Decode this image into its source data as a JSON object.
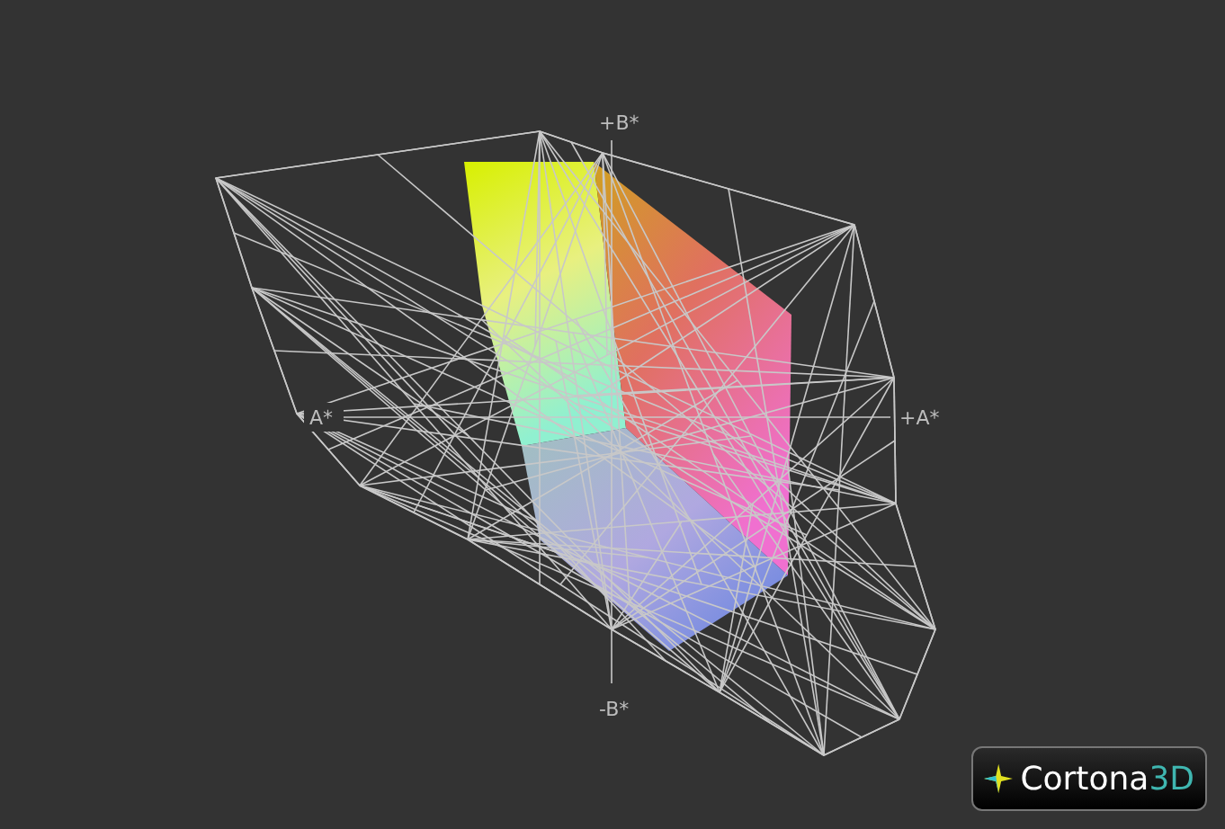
{
  "viewport": {
    "axes": [
      {
        "label": "+B*"
      },
      {
        "label": "+A*"
      },
      {
        "label": "-B*"
      },
      {
        "label": "A*"
      }
    ]
  },
  "logo": {
    "name": "Cortona",
    "suffix": "3D"
  }
}
